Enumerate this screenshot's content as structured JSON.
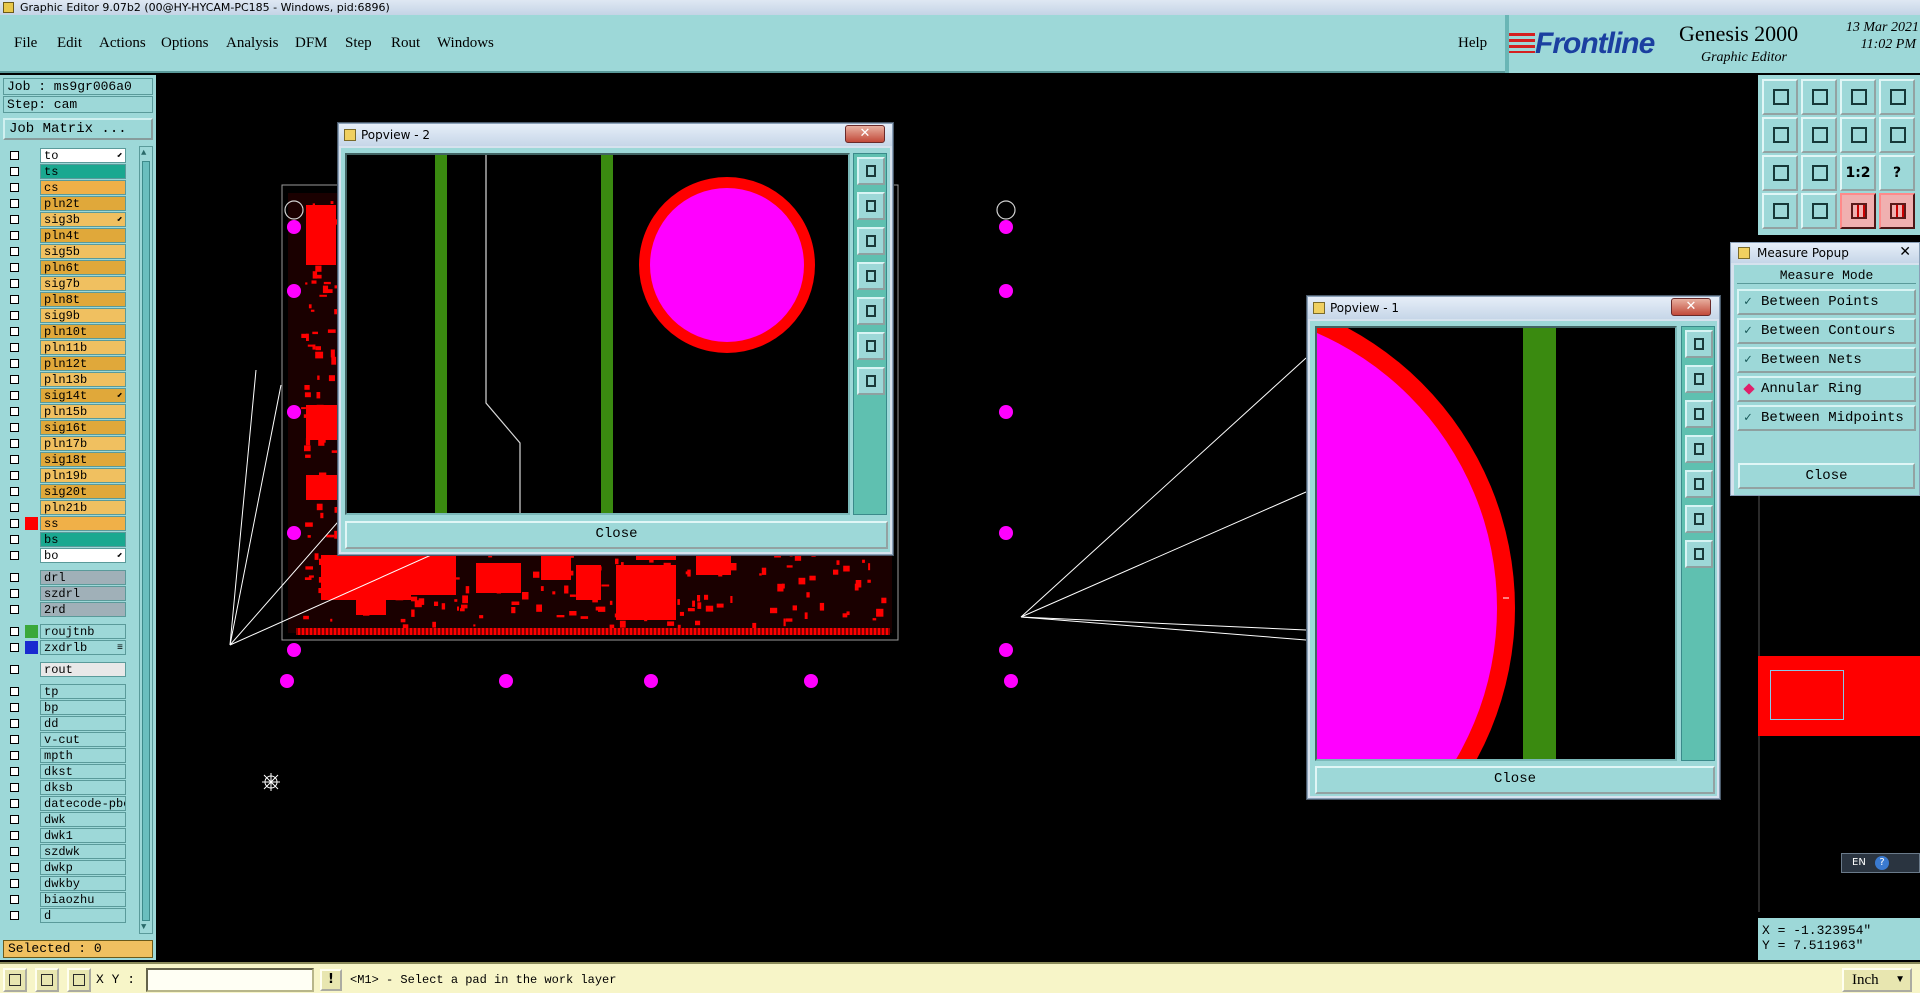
{
  "window": {
    "title": "Graphic Editor 9.07b2 (00@HY-HYCAM-PC185 - Windows, pid:6896)"
  },
  "menu": {
    "items": [
      "File",
      "Edit",
      "Actions",
      "Options",
      "Analysis",
      "DFM",
      "Step",
      "Rout",
      "Windows"
    ],
    "help": "Help"
  },
  "brand": {
    "logo": "Frontline",
    "product": "Genesis 2000",
    "subtitle": "Graphic Editor",
    "date": "13 Mar 2021",
    "time": "11:02 PM"
  },
  "left": {
    "job": "Job : ms9gr006a0",
    "step": "Step: cam",
    "job_matrix": "Job Matrix ...",
    "selected": "Selected : 0",
    "layers": [
      {
        "name": "to",
        "bg": "#ffffff",
        "swatch": "",
        "mark": "⬋"
      },
      {
        "name": "ts",
        "bg": "#1aa890",
        "swatch": "",
        "mark": ""
      },
      {
        "name": "cs",
        "bg": "#f0b048",
        "swatch": "",
        "mark": ""
      },
      {
        "name": "pln2t",
        "bg": "#e0a83a",
        "swatch": "",
        "mark": ""
      },
      {
        "name": "sig3b",
        "bg": "#f0c060",
        "swatch": "",
        "mark": "⬋"
      },
      {
        "name": "pln4t",
        "bg": "#e0a83a",
        "swatch": "",
        "mark": ""
      },
      {
        "name": "sig5b",
        "bg": "#f0c060",
        "swatch": "",
        "mark": ""
      },
      {
        "name": "pln6t",
        "bg": "#e0a83a",
        "swatch": "",
        "mark": ""
      },
      {
        "name": "sig7b",
        "bg": "#f0c060",
        "swatch": "",
        "mark": ""
      },
      {
        "name": "pln8t",
        "bg": "#e0a83a",
        "swatch": "",
        "mark": ""
      },
      {
        "name": "sig9b",
        "bg": "#f0c060",
        "swatch": "",
        "mark": ""
      },
      {
        "name": "pln10t",
        "bg": "#e0a83a",
        "swatch": "",
        "mark": ""
      },
      {
        "name": "pln11b",
        "bg": "#f0c060",
        "swatch": "",
        "mark": ""
      },
      {
        "name": "pln12t",
        "bg": "#e0a83a",
        "swatch": "",
        "mark": ""
      },
      {
        "name": "pln13b",
        "bg": "#f0c060",
        "swatch": "",
        "mark": ""
      },
      {
        "name": "sig14t",
        "bg": "#e0a83a",
        "swatch": "",
        "mark": "⬋"
      },
      {
        "name": "pln15b",
        "bg": "#f0c060",
        "swatch": "",
        "mark": ""
      },
      {
        "name": "sig16t",
        "bg": "#e0a83a",
        "swatch": "",
        "mark": ""
      },
      {
        "name": "pln17b",
        "bg": "#f0c060",
        "swatch": "",
        "mark": ""
      },
      {
        "name": "sig18t",
        "bg": "#e0a83a",
        "swatch": "",
        "mark": ""
      },
      {
        "name": "pln19b",
        "bg": "#f0c060",
        "swatch": "",
        "mark": ""
      },
      {
        "name": "sig20t",
        "bg": "#e0a83a",
        "swatch": "",
        "mark": ""
      },
      {
        "name": "pln21b",
        "bg": "#f0c060",
        "swatch": "",
        "mark": ""
      },
      {
        "name": "ss",
        "bg": "#f0b048",
        "swatch": "#ff0000",
        "mark": ""
      },
      {
        "name": "bs",
        "bg": "#1aa890",
        "swatch": "",
        "mark": ""
      },
      {
        "name": "bo",
        "bg": "#ffffff",
        "swatch": "",
        "mark": "⬋"
      },
      {
        "name": "drl",
        "bg": "#a0b0b8",
        "swatch": "",
        "mark": ""
      },
      {
        "name": "szdrl",
        "bg": "#a0b0b8",
        "swatch": "",
        "mark": ""
      },
      {
        "name": "2rd",
        "bg": "#a0b0b8",
        "swatch": "",
        "mark": ""
      },
      {
        "name": "roujtnb",
        "bg": "#9dd8d8",
        "swatch": "#3aa83a",
        "mark": ""
      },
      {
        "name": "zxdrlb",
        "bg": "#9dd8d8",
        "swatch": "#1a2ad0",
        "mark": "≡"
      },
      {
        "name": "rout",
        "bg": "#e8e8e8",
        "swatch": "",
        "mark": ""
      },
      {
        "name": "tp",
        "bg": "#9dd8d8",
        "swatch": "",
        "mark": ""
      },
      {
        "name": "bp",
        "bg": "#9dd8d8",
        "swatch": "",
        "mark": ""
      },
      {
        "name": "dd",
        "bg": "#9dd8d8",
        "swatch": "",
        "mark": ""
      },
      {
        "name": "v-cut",
        "bg": "#9dd8d8",
        "swatch": "",
        "mark": ""
      },
      {
        "name": "mpth",
        "bg": "#9dd8d8",
        "swatch": "",
        "mark": ""
      },
      {
        "name": "dkst",
        "bg": "#9dd8d8",
        "swatch": "",
        "mark": ""
      },
      {
        "name": "dksb",
        "bg": "#9dd8d8",
        "swatch": "",
        "mark": ""
      },
      {
        "name": "datecode-pbe",
        "bg": "#9dd8d8",
        "swatch": "",
        "mark": ""
      },
      {
        "name": "dwk",
        "bg": "#9dd8d8",
        "swatch": "",
        "mark": ""
      },
      {
        "name": "dwk1",
        "bg": "#9dd8d8",
        "swatch": "",
        "mark": ""
      },
      {
        "name": "szdwk",
        "bg": "#9dd8d8",
        "swatch": "",
        "mark": ""
      },
      {
        "name": "dwkp",
        "bg": "#9dd8d8",
        "swatch": "",
        "mark": ""
      },
      {
        "name": "dwkby",
        "bg": "#9dd8d8",
        "swatch": "",
        "mark": ""
      },
      {
        "name": "biaozhu",
        "bg": "#9dd8d8",
        "swatch": "",
        "mark": ""
      },
      {
        "name": "d",
        "bg": "#9dd8d8",
        "swatch": "",
        "mark": ""
      }
    ]
  },
  "popview2": {
    "title": "Popview - 2",
    "close_x": "✕",
    "close_label": "Close"
  },
  "popview1": {
    "title": "Popview - 1",
    "close_x": "✕",
    "close_label": "Close"
  },
  "measure": {
    "title": "Measure Popup",
    "close_x": "✕",
    "heading": "Measure Mode",
    "options": [
      {
        "label": "Between Points",
        "selected": false
      },
      {
        "label": "Between Contours",
        "selected": false
      },
      {
        "label": "Between Nets",
        "selected": false
      },
      {
        "label": "Annular Ring",
        "selected": true
      },
      {
        "label": "Between Midpoints",
        "selected": false
      }
    ],
    "close_label": "Close"
  },
  "toolbar_right": {
    "one_to_two": "1:2",
    "help": "?"
  },
  "coords": {
    "x": "X = -1.323954\"",
    "y": "Y = 7.511963\""
  },
  "ime": {
    "lang": "EN",
    "help": "?"
  },
  "status": {
    "xy_label": "X Y :",
    "xy_value": "",
    "excl": "!",
    "message": "<M1> - Select a pad in the work layer",
    "units": "Inch"
  },
  "colors": {
    "panel": "#9dd8d8",
    "copper": "#ff0000",
    "pad_magenta": "#ff00ff",
    "trace_green": "#3a8a10",
    "status_bg": "#f7f5c8"
  }
}
